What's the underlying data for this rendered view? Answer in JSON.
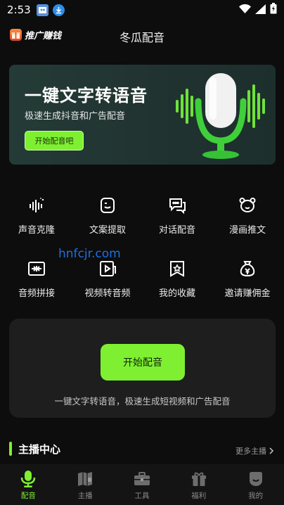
{
  "status_bar": {
    "time": "2:53"
  },
  "header": {
    "promo_label": "推广赚钱",
    "title": "冬瓜配音"
  },
  "banner": {
    "title": "一键文字转语音",
    "subtitle": "极速生成抖音和广告配音",
    "button_label": "开始配音吧"
  },
  "features": [
    {
      "label": "声音克隆",
      "icon": "sound-wave-icon"
    },
    {
      "label": "文案提取",
      "icon": "text-extract-icon"
    },
    {
      "label": "对话配音",
      "icon": "chat-bubbles-icon"
    },
    {
      "label": "漫画推文",
      "icon": "bear-face-icon"
    },
    {
      "label": "音频拼接",
      "icon": "audio-merge-icon"
    },
    {
      "label": "视频转音频",
      "icon": "video-to-audio-icon"
    },
    {
      "label": "我的收藏",
      "icon": "star-bookmark-icon"
    },
    {
      "label": "邀请赚佣金",
      "icon": "money-bag-icon"
    }
  ],
  "watermark": "hnfcjr.com",
  "start_card": {
    "button_label": "开始配音",
    "description": "一键文字转语音，极速生成短视频和广告配音"
  },
  "anchor_section": {
    "title": "主播中心",
    "more_label": "更多主播"
  },
  "tabs": [
    {
      "label": "配音",
      "icon": "microphone-icon",
      "active": true
    },
    {
      "label": "主播",
      "icon": "book-icon",
      "active": false
    },
    {
      "label": "工具",
      "icon": "toolbox-icon",
      "active": false
    },
    {
      "label": "福利",
      "icon": "gift-icon",
      "active": false
    },
    {
      "label": "我的",
      "icon": "profile-icon",
      "active": false
    }
  ],
  "colors": {
    "accent": "#7ef031",
    "background": "#0d0d0d",
    "card": "#1e1e1e"
  }
}
